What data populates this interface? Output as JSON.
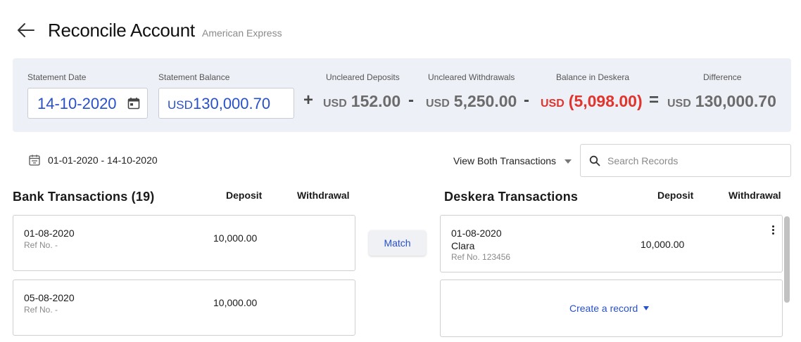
{
  "header": {
    "title": "Reconcile Account",
    "subtitle": "American Express"
  },
  "summary": {
    "statement_date_label": "Statement Date",
    "statement_date_value": "14-10-2020",
    "statement_balance_label": "Statement Balance",
    "statement_balance_currency": "USD",
    "statement_balance_value": "130,000.70",
    "uncleared_deposits_label": "Uncleared Deposits",
    "uncleared_deposits_currency": "USD",
    "uncleared_deposits_value": "152.00",
    "uncleared_withdrawals_label": "Uncleared Withdrawals",
    "uncleared_withdrawals_currency": "USD",
    "uncleared_withdrawals_value": "5,250.00",
    "balance_deskera_label": "Balance in Deskera",
    "balance_deskera_currency": "USD",
    "balance_deskera_value": "(5,098.00)",
    "difference_label": "Difference",
    "difference_currency": "USD",
    "difference_value": "130,000.70",
    "op_plus": "+",
    "op_minus_1": "-",
    "op_minus_2": "-",
    "op_equals": "=",
    "negative_color": "#e0342c"
  },
  "filters": {
    "date_range": "01-01-2020 - 14-10-2020",
    "view_select": "View Both Transactions",
    "search_placeholder": "Search Records"
  },
  "bank": {
    "title": "Bank Transactions (19)",
    "col_deposit": "Deposit",
    "col_withdrawal": "Withdrawal",
    "rows": [
      {
        "date": "01-08-2020",
        "ref": "Ref No. -",
        "deposit": "10,000.00"
      },
      {
        "date": "05-08-2020",
        "ref": "Ref No. -",
        "deposit": "10,000.00"
      }
    ]
  },
  "match": {
    "label": "Match"
  },
  "deskera": {
    "title": "Deskera Transactions",
    "col_deposit": "Deposit",
    "col_withdrawal": "Withdrawal",
    "rows": [
      {
        "date": "01-08-2020",
        "name": "Clara",
        "ref": "Ref No. 123456",
        "deposit": "10,000.00"
      }
    ],
    "create_record": "Create a record"
  },
  "colors": {
    "accent": "#2850c8",
    "panel_bg": "#eef0f7"
  },
  "icons": {
    "back": "arrow-left-icon",
    "calendar": "calendar-icon",
    "date_range": "calendar-filter-icon",
    "search": "search-icon",
    "dropdown": "caret-down-icon",
    "more": "kebab-icon"
  }
}
